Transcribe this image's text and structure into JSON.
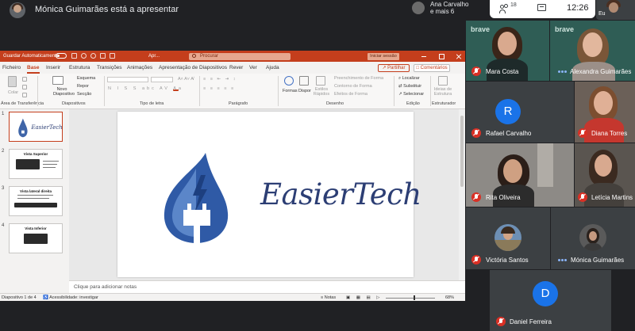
{
  "meet": {
    "presenting_label": "Mónica Guimarães está a apresentar",
    "participants_chip": {
      "line1": "Ana Carvalho",
      "line2": "e mais 6"
    },
    "people_count": "18",
    "time": "12:26",
    "self_label": "Eu",
    "icons": [
      "people-icon",
      "chat-icon",
      "mic-off-icon",
      "more-icon"
    ],
    "accent_blue": "#1a73e8",
    "mic_off_color": "#d93025"
  },
  "ppt": {
    "autosave_label": "Guardar Automaticamente",
    "doc_title": "Apr...",
    "search_placeholder": "Procurar",
    "signin_label": "Iniciar sessão",
    "brand_color": "#c43e1c",
    "tabs": [
      {
        "label": "Ficheiro"
      },
      {
        "label": "Base"
      },
      {
        "label": "Inserir"
      },
      {
        "label": "Estrutura"
      },
      {
        "label": "Transições"
      },
      {
        "label": "Animações"
      },
      {
        "label": "Apresentação de Diapositivos"
      },
      {
        "label": "Rever"
      },
      {
        "label": "Ver"
      },
      {
        "label": "Ajuda"
      }
    ],
    "share_label": "Partilhar",
    "comments_label": "Comentários",
    "ribbon": {
      "clipboard": {
        "paste": "Colar",
        "group": "Área de Transferência"
      },
      "slides": {
        "new_slide": "Novo Diapositivo",
        "layout": "Esquema",
        "reset": "Repor",
        "section": "Secção",
        "group": "Diapositivos"
      },
      "font": {
        "group": "Tipo de letra"
      },
      "paragraph": {
        "group": "Parágrafo"
      },
      "drawing": {
        "shapes": "Formas",
        "arrange": "Dispor",
        "quick_styles": "Estilos Rápidos",
        "fill": "Preenchimento de Forma",
        "outline": "Contorno de Forma",
        "effects": "Efeitos de Forma",
        "group": "Desenho"
      },
      "editing": {
        "find": "Localizar",
        "replace": "Substituir",
        "select": "Selecionar",
        "group": "Edição"
      },
      "designer": {
        "ideas": "Ideias de Estrutura",
        "group": "Estruturador"
      }
    },
    "slides": [
      {
        "num": "1",
        "title": "EasierTech"
      },
      {
        "num": "2",
        "title": "Vista Superior"
      },
      {
        "num": "3",
        "title": "Vista lateral direita"
      },
      {
        "num": "4",
        "title": "Vista Inferior"
      }
    ],
    "main_slide": {
      "title": "EasierTech"
    },
    "notes_placeholder": "Clique para adicionar notas",
    "status": {
      "slide_of": "Diapositivo 1 de 4",
      "accessibility": "Acessibilidade: investigar",
      "notes": "Notas",
      "zoom": "68%"
    }
  },
  "video_tiles": [
    {
      "name": "Mara Costa",
      "muted": true
    },
    {
      "name": "Alexandra Guimarães",
      "muted": false
    },
    {
      "name": "Rafael Carvalho",
      "muted": true,
      "avatar_letter": "R",
      "avatar_color": "#1a73e8"
    },
    {
      "name": "Diana Torres",
      "muted": true
    },
    {
      "name": "Rita Oliveira",
      "muted": true
    },
    {
      "name": "Letícia Martins",
      "muted": true
    },
    {
      "name": "Victória Santos",
      "muted": true
    },
    {
      "name": "Mónica Guimarães",
      "muted": false
    },
    {
      "name": "Daniel Ferreira",
      "muted": true,
      "avatar_letter": "D",
      "avatar_color": "#1a73e8"
    }
  ],
  "tile_brand_text": "brave"
}
